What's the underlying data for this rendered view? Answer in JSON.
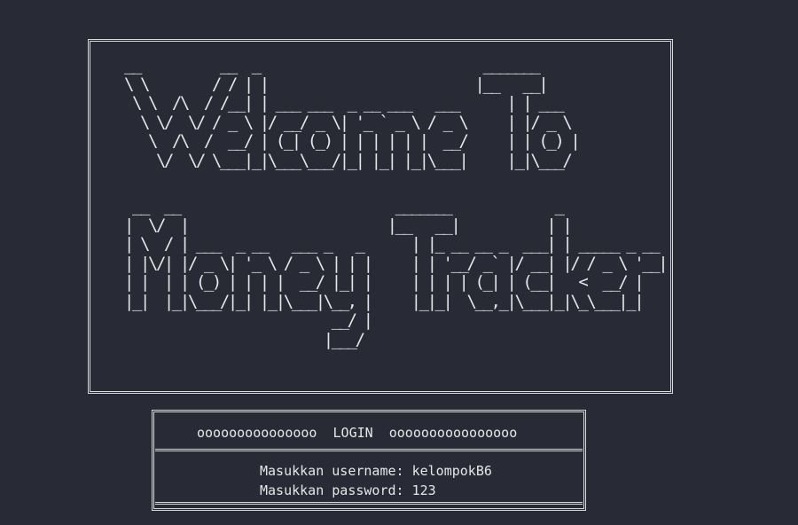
{
  "banner": {
    "line1_art": " __          __  _                            _______        \n \\ \\        / / | |                          |__   __|       \n  \\ \\  /\\  / /__| | ___ ___  _ __ ___   ___      | | ___    \n   \\ \\/  \\/ / _ \\ |/ __/ _ \\| '_ ` _ \\ / _ \\     | |/ _ \\   \n    \\  /\\  /  __/ | (_| (_) | | | | | |  __/     | | (_) |  \n     \\/  \\/ \\___|_|\\___\\___/|_| |_| |_|\\___|     |_|\\___/   ",
    "line2_art": "  __  __                           _______             _             \n |  \\/  |                         |__   __|           | |            \n | \\  / | ___  _ __   ___ _   _      | |_ __ __ _  ___| | _____ _ __ \n | |\\/| |/ _ \\| '_ \\ / _ \\ | | |     | | '__/ _` |/ __| |/ / _ \\ '__|\n | |  | | (_) | | | |  __/ |_| |     | | | | (_| | (__|   <  __/ |   \n |_|  |_|\\___/|_| |_|\\___|\\__, |     |_|_|  \\__,_|\\___|_|\\_\\___|_|   \n                           __/ |                                     \n                          |___/                                      "
  },
  "login": {
    "title": "ooooooooooooooo  LOGIN  oooooooooooooooo",
    "username_row": "Masukkan username: kelompokB6",
    "password_row": "Masukkan password: 123"
  },
  "footer": {
    "partial_text": "- . - . - . -.- . - . - . - . - . -.-"
  }
}
